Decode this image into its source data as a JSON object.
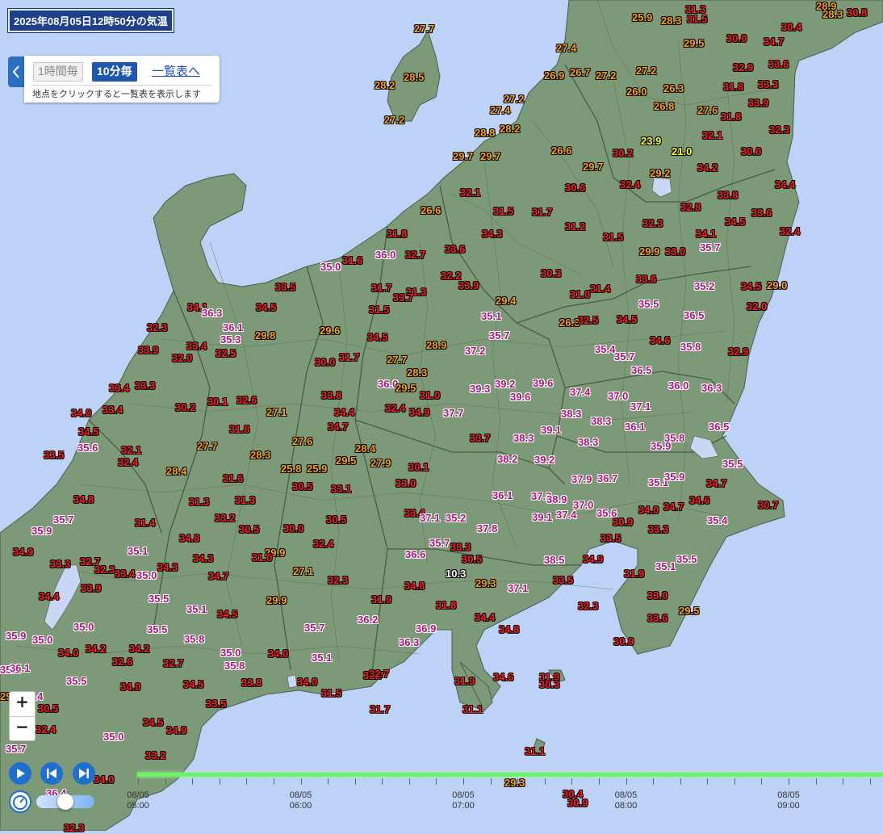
{
  "header": {
    "title": "2025年08月05日12時50分の気温"
  },
  "mode_panel": {
    "tab_hourly": "1時間毎",
    "tab_10min": "10分毎",
    "active_tab": "10分毎",
    "list_link": "一覧表へ",
    "hint": "地点をクリックすると一覧表を表示します"
  },
  "zoom": {
    "in": "+",
    "out": "−"
  },
  "colors": {
    "sea": "#bcd3f7",
    "land": "#7c9a78",
    "lake": "#cbd6f5",
    "under_25": "#ffffff",
    "from_25": "#ff9f1e",
    "from_30": "#ff1e1e",
    "from_35": "#b0107a",
    "band_20_25": "#ffff33",
    "accent": "#1f57ad",
    "timeline": "#6ff266"
  },
  "playback": {
    "play_icon": "play-icon",
    "prev_icon": "skip-back-icon",
    "next_icon": "skip-forward-icon",
    "speed_level": 0.5
  },
  "timeline": {
    "labels": [
      {
        "date": "08/05",
        "time": "05:00"
      },
      {
        "date": "08/05",
        "time": "06:00"
      },
      {
        "date": "08/05",
        "time": "07:00"
      },
      {
        "date": "08/05",
        "time": "08:00"
      },
      {
        "date": "08/05",
        "time": "09:00"
      }
    ]
  },
  "temperatures": [
    [
      "27.7",
      513,
      28
    ],
    [
      "28.2",
      464,
      98
    ],
    [
      "28.5",
      500,
      88
    ],
    [
      "27.2",
      476,
      141
    ],
    [
      "25.9",
      783,
      14
    ],
    [
      "28.3",
      819,
      18
    ],
    [
      "31.3",
      849,
      4
    ],
    [
      "31.5",
      851,
      16
    ],
    [
      "28.9",
      1011,
      0
    ],
    [
      "28.3",
      1019,
      10
    ],
    [
      "30.8",
      1049,
      8
    ],
    [
      "29.5",
      847,
      46
    ],
    [
      "30.0",
      900,
      40
    ],
    [
      "34.7",
      946,
      44
    ],
    [
      "30.4",
      968,
      26
    ],
    [
      "27.4",
      689,
      52
    ],
    [
      "26.9",
      674,
      86
    ],
    [
      "26.7",
      706,
      82
    ],
    [
      "27.2",
      738,
      86
    ],
    [
      "27.2",
      788,
      80
    ],
    [
      "32.9",
      908,
      76
    ],
    [
      "33.6",
      952,
      72
    ],
    [
      "26.0",
      776,
      106
    ],
    [
      "26.3",
      822,
      102
    ],
    [
      "31.8",
      896,
      100
    ],
    [
      "33.3",
      939,
      97
    ],
    [
      "27.2",
      624,
      115
    ],
    [
      "27.4",
      607,
      129
    ],
    [
      "26.8",
      810,
      124
    ],
    [
      "27.6",
      864,
      129
    ],
    [
      "31.8",
      893,
      137
    ],
    [
      "33.9",
      927,
      120
    ],
    [
      "28.8",
      588,
      157
    ],
    [
      "28.2",
      619,
      152
    ],
    [
      "32.1",
      870,
      160
    ],
    [
      "32.3",
      953,
      153
    ],
    [
      "29.7",
      561,
      186
    ],
    [
      "29.7",
      595,
      186
    ],
    [
      "26.6",
      683,
      179
    ],
    [
      "30.2",
      759,
      182
    ],
    [
      "23.9",
      794,
      167
    ],
    [
      "21.0",
      832,
      180
    ],
    [
      "30.0",
      918,
      180
    ],
    [
      "29.7",
      722,
      199
    ],
    [
      "29.2",
      805,
      207
    ],
    [
      "34.2",
      864,
      200
    ],
    [
      "30.6",
      700,
      225
    ],
    [
      "32.4",
      768,
      221
    ],
    [
      "34.4",
      960,
      221
    ],
    [
      "32.1",
      570,
      231
    ],
    [
      "33.8",
      889,
      234
    ],
    [
      "26.6",
      521,
      253
    ],
    [
      "31.5",
      611,
      254
    ],
    [
      "31.7",
      659,
      255
    ],
    [
      "32.8",
      843,
      249
    ],
    [
      "33.6",
      931,
      256
    ],
    [
      "31.2",
      700,
      273
    ],
    [
      "32.3",
      796,
      269
    ],
    [
      "34.5",
      898,
      267
    ],
    [
      "34.3",
      597,
      282
    ],
    [
      "31.8",
      479,
      282
    ],
    [
      "31.5",
      747,
      286
    ],
    [
      "34.1",
      862,
      282
    ],
    [
      "32.4",
      966,
      279
    ],
    [
      "33.6",
      551,
      301
    ],
    [
      "32.7",
      502,
      308
    ],
    [
      "29.9",
      792,
      304
    ],
    [
      "33.0",
      824,
      304
    ],
    [
      "35.7",
      867,
      299
    ],
    [
      "35.0",
      397,
      323
    ],
    [
      "31.6",
      424,
      315
    ],
    [
      "36.0",
      465,
      308
    ],
    [
      "30.3",
      670,
      331
    ],
    [
      "32.2",
      546,
      334
    ],
    [
      "33.9",
      568,
      346
    ],
    [
      "33.6",
      788,
      338
    ],
    [
      "35.2",
      860,
      347
    ],
    [
      "34.5",
      918,
      347
    ],
    [
      "29.0",
      950,
      346
    ],
    [
      "33.5",
      341,
      348
    ],
    [
      "31.7",
      460,
      349
    ],
    [
      "31.3",
      503,
      354
    ],
    [
      "33.7",
      487,
      361
    ],
    [
      "31.0",
      706,
      357
    ],
    [
      "31.4",
      731,
      350
    ],
    [
      "29.4",
      614,
      365
    ],
    [
      "35.5",
      791,
      369
    ],
    [
      "32.0",
      925,
      372
    ],
    [
      "34.5",
      317,
      373
    ],
    [
      "34.1",
      232,
      373
    ],
    [
      "36.3",
      250,
      380
    ],
    [
      "31.5",
      457,
      376
    ],
    [
      "35.1",
      596,
      384
    ],
    [
      "36.5",
      847,
      383
    ],
    [
      "29.6",
      396,
      402
    ],
    [
      "26.3",
      693,
      392
    ],
    [
      "32.5",
      716,
      389
    ],
    [
      "34.5",
      764,
      388
    ],
    [
      "32.3",
      182,
      398
    ],
    [
      "36.1",
      276,
      398
    ],
    [
      "35.3",
      273,
      413
    ],
    [
      "29.8",
      316,
      408
    ],
    [
      "34.5",
      455,
      410
    ],
    [
      "35.7",
      606,
      408
    ],
    [
      "34.6",
      805,
      414
    ],
    [
      "33.4",
      231,
      421
    ],
    [
      "32.5",
      267,
      430
    ],
    [
      "28.9",
      528,
      420
    ],
    [
      "37.2",
      576,
      427
    ],
    [
      "35.4",
      737,
      425
    ],
    [
      "35.8",
      843,
      422
    ],
    [
      "32.9",
      902,
      428
    ],
    [
      "33.9",
      171,
      426
    ],
    [
      "32.0",
      213,
      436
    ],
    [
      "30.0",
      390,
      441
    ],
    [
      "31.7",
      420,
      435
    ],
    [
      "27.7",
      479,
      438
    ],
    [
      "35.7",
      761,
      434
    ],
    [
      "28.3",
      504,
      454
    ],
    [
      "36.5",
      782,
      451
    ],
    [
      "36.0",
      468,
      468
    ],
    [
      "29.5",
      490,
      473
    ],
    [
      "39.2",
      613,
      468
    ],
    [
      "39.6",
      660,
      467
    ],
    [
      "36.0",
      828,
      470
    ],
    [
      "36.3",
      869,
      473
    ],
    [
      "33.4",
      135,
      473
    ],
    [
      "33.3",
      167,
      470
    ],
    [
      "33.8",
      398,
      482
    ],
    [
      "31.0",
      520,
      482
    ],
    [
      "39.3",
      582,
      474
    ],
    [
      "39.6",
      632,
      484
    ],
    [
      "37.4",
      706,
      478
    ],
    [
      "37.0",
      753,
      483
    ],
    [
      "30.2",
      217,
      497
    ],
    [
      "30.1",
      257,
      490
    ],
    [
      "32.6",
      293,
      488
    ],
    [
      "37.1",
      781,
      496
    ],
    [
      "34.0",
      88,
      504
    ],
    [
      "33.4",
      127,
      500
    ],
    [
      "27.1",
      330,
      503
    ],
    [
      "34.4",
      414,
      503
    ],
    [
      "32.4",
      477,
      498
    ],
    [
      "34.9",
      507,
      503
    ],
    [
      "37.7",
      549,
      504
    ],
    [
      "38.3",
      695,
      505
    ],
    [
      "34.5",
      97,
      527
    ],
    [
      "31.8",
      284,
      524
    ],
    [
      "34.7",
      406,
      521
    ],
    [
      "39.1",
      670,
      525
    ],
    [
      "38.3",
      732,
      514
    ],
    [
      "36.1",
      774,
      521
    ],
    [
      "36.5",
      878,
      521
    ],
    [
      "35.6",
      96,
      547
    ],
    [
      "32.1",
      150,
      550
    ],
    [
      "27.7",
      244,
      545
    ],
    [
      "27.6",
      362,
      539
    ],
    [
      "28.4",
      440,
      548
    ],
    [
      "33.7",
      582,
      535
    ],
    [
      "38.3",
      636,
      535
    ],
    [
      "38.3",
      716,
      540
    ],
    [
      "35.8",
      823,
      535
    ],
    [
      "33.5",
      54,
      556
    ],
    [
      "32.4",
      146,
      565
    ],
    [
      "28.3",
      310,
      556
    ],
    [
      "35.9",
      806,
      545
    ],
    [
      "28.4",
      206,
      576
    ],
    [
      "25.8",
      348,
      573
    ],
    [
      "25.9",
      380,
      573
    ],
    [
      "29.5",
      416,
      563
    ],
    [
      "27.9",
      459,
      566
    ],
    [
      "38.2",
      616,
      561
    ],
    [
      "39.2",
      662,
      562
    ],
    [
      "35.5",
      895,
      567
    ],
    [
      "30.1",
      506,
      571
    ],
    [
      "31.6",
      276,
      585
    ],
    [
      "37.9",
      708,
      586
    ],
    [
      "36.7",
      740,
      585
    ],
    [
      "35.1",
      803,
      590
    ],
    [
      "35.9",
      823,
      583
    ],
    [
      "34.7",
      875,
      591
    ],
    [
      "30.5",
      362,
      595
    ],
    [
      "33.1",
      410,
      598
    ],
    [
      "33.0",
      490,
      591
    ],
    [
      "34.8",
      91,
      611
    ],
    [
      "36.1",
      610,
      606
    ],
    [
      "37.3",
      658,
      607
    ],
    [
      "38.9",
      677,
      611
    ],
    [
      "37.0",
      710,
      618
    ],
    [
      "34.7",
      822,
      620
    ],
    [
      "34.6",
      854,
      612
    ],
    [
      "30.7",
      939,
      618
    ],
    [
      "31.3",
      234,
      614
    ],
    [
      "31.3",
      291,
      612
    ],
    [
      "33.4",
      501,
      628
    ],
    [
      "37.1",
      520,
      634
    ],
    [
      "35.2",
      552,
      634
    ],
    [
      "39.1",
      659,
      633
    ],
    [
      "37.4",
      689,
      630
    ],
    [
      "35.6",
      739,
      628
    ],
    [
      "34.0",
      791,
      624
    ],
    [
      "35.7",
      66,
      636
    ],
    [
      "31.4",
      167,
      640
    ],
    [
      "33.2",
      266,
      634
    ],
    [
      "30.5",
      404,
      636
    ],
    [
      "30.9",
      759,
      639
    ],
    [
      "35.4",
      876,
      637
    ],
    [
      "35.9",
      39,
      650
    ],
    [
      "30.5",
      296,
      648
    ],
    [
      "30.0",
      351,
      647
    ],
    [
      "37.8",
      591,
      647
    ],
    [
      "33.3",
      803,
      648
    ],
    [
      "34.8",
      222,
      659
    ],
    [
      "32.4",
      388,
      666
    ],
    [
      "35.7",
      532,
      665
    ],
    [
      "33.3",
      558,
      670
    ],
    [
      "33.5",
      744,
      659
    ],
    [
      "34.9",
      16,
      676
    ],
    [
      "35.1",
      158,
      675
    ],
    [
      "29.9",
      328,
      677
    ],
    [
      "31.0",
      312,
      683
    ],
    [
      "36.6",
      502,
      679
    ],
    [
      "30.5",
      572,
      685
    ],
    [
      "38.5",
      674,
      686
    ],
    [
      "34.9",
      722,
      685
    ],
    [
      "35.5",
      838,
      685
    ],
    [
      "33.3",
      62,
      691
    ],
    [
      "32.7",
      99,
      688
    ],
    [
      "32.3",
      117,
      698
    ],
    [
      "33.4",
      142,
      703
    ],
    [
      "34.3",
      195,
      695
    ],
    [
      "34.3",
      239,
      684
    ],
    [
      "35.0",
      169,
      705
    ],
    [
      "27.1",
      363,
      700
    ],
    [
      "35.1",
      812,
      694
    ],
    [
      "34.7",
      258,
      706
    ],
    [
      "32.3",
      406,
      711
    ],
    [
      "10.3",
      552,
      703
    ],
    [
      "29.3",
      589,
      715
    ],
    [
      "33.5",
      685,
      711
    ],
    [
      "31.9",
      773,
      703
    ],
    [
      "33.9",
      100,
      721
    ],
    [
      "34.4",
      48,
      731
    ],
    [
      "34.8",
      501,
      718
    ],
    [
      "37.1",
      629,
      721
    ],
    [
      "33.0",
      802,
      730
    ],
    [
      "35.5",
      184,
      734
    ],
    [
      "29.9",
      330,
      736
    ],
    [
      "31.9",
      460,
      735
    ],
    [
      "31.8",
      540,
      742
    ],
    [
      "32.3",
      716,
      743
    ],
    [
      "35.1",
      231,
      747
    ],
    [
      "34.5",
      269,
      753
    ],
    [
      "36.2",
      443,
      760
    ],
    [
      "34.4",
      588,
      757
    ],
    [
      "29.5",
      841,
      749
    ],
    [
      "33.6",
      802,
      758
    ],
    [
      "35.0",
      91,
      769
    ],
    [
      "35.5",
      182,
      772
    ],
    [
      "35.7",
      377,
      770
    ],
    [
      "36.9",
      515,
      771
    ],
    [
      "34.8",
      618,
      772
    ],
    [
      "35.9",
      7,
      780
    ],
    [
      "35.0",
      40,
      785
    ],
    [
      "35.8",
      228,
      784
    ],
    [
      "36.3",
      494,
      788
    ],
    [
      "30.9",
      760,
      787
    ],
    [
      "34.0",
      72,
      801
    ],
    [
      "34.2",
      106,
      796
    ],
    [
      "34.2",
      160,
      796
    ],
    [
      "35.0",
      273,
      801
    ],
    [
      "34.0",
      332,
      802
    ],
    [
      "35.1",
      386,
      807
    ],
    [
      "32.6",
      139,
      812
    ],
    [
      "32.7",
      202,
      814
    ],
    [
      "35.8",
      278,
      817
    ],
    [
      "32.7",
      450,
      829
    ],
    [
      "32.7",
      457,
      827
    ],
    [
      "35.1",
      0,
      822
    ],
    [
      "36.1",
      12,
      820
    ],
    [
      "35.5",
      82,
      836
    ],
    [
      "34.5",
      227,
      840
    ],
    [
      "33.8",
      299,
      838
    ],
    [
      "34.0",
      368,
      837
    ],
    [
      "31.9",
      563,
      836
    ],
    [
      "34.6",
      611,
      831
    ],
    [
      "31.9",
      668,
      831
    ],
    [
      "30.3",
      668,
      840
    ],
    [
      "34.0",
      149,
      843
    ],
    [
      "31.5",
      398,
      851
    ],
    [
      "29.0",
      0,
      855
    ],
    [
      "35.4",
      28,
      855
    ],
    [
      "33.5",
      255,
      864
    ],
    [
      "31.7",
      458,
      871
    ],
    [
      "31.1",
      573,
      871
    ],
    [
      "30.5",
      47,
      870
    ],
    [
      "34.5",
      177,
      887
    ],
    [
      "34.9",
      206,
      897
    ],
    [
      "32.4",
      44,
      896
    ],
    [
      "35.0",
      128,
      905
    ],
    [
      "33.2",
      180,
      928
    ],
    [
      "31.1",
      650,
      923
    ],
    [
      "35.7",
      7,
      920
    ],
    [
      "34.0",
      116,
      958
    ],
    [
      "29.3",
      625,
      962
    ],
    [
      "36.4",
      57,
      975
    ],
    [
      "30.4",
      697,
      976
    ],
    [
      "30.9",
      703,
      987
    ],
    [
      "32.3",
      79,
      1018
    ]
  ]
}
